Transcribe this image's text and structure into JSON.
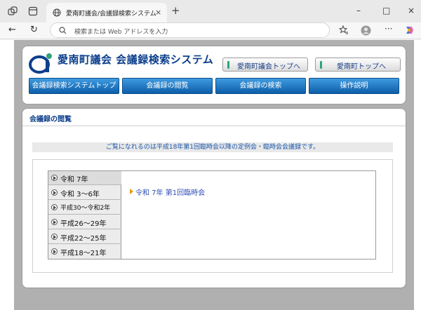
{
  "browser": {
    "tab_title": "愛南町議会/会議録検索システム",
    "tab_close": "×",
    "new_tab": "+",
    "address_placeholder": "検索または Web アドレスを入力",
    "window_buttons": [
      "–",
      "□",
      "×"
    ]
  },
  "site": {
    "logo_text": "愛南町議会 会議録検索システム",
    "top_links": [
      "愛南町議会トップへ",
      "愛南町トップへ"
    ],
    "nav": [
      "会議録検索システムトップ",
      "会議録の閲覧",
      "会議録の検索",
      "操作説明"
    ]
  },
  "main": {
    "title": "会議録の閲覧",
    "notice": "ご覧になれるのは平成18年第1回臨時会以降の定例会・臨時会会議録です。",
    "years": [
      "令和 7年",
      "令和 3～6年",
      "平成30～令和2年",
      "平成26～29年",
      "平成22～25年",
      "平成18～21年"
    ],
    "selected_year_index": 0,
    "sessions": [
      "令和 7年 第1回臨時会"
    ]
  },
  "colors": {
    "brand": "#0c3f8c",
    "nav_blue": "#0d5ea9",
    "link": "#2f4fb4",
    "marker": "#e89a12"
  }
}
